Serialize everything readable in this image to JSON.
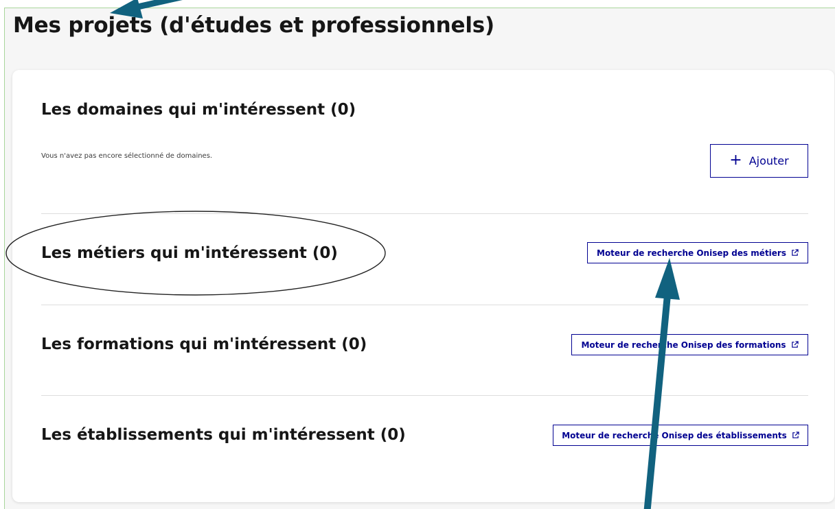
{
  "page": {
    "title": "Mes projets (d'études et professionnels)"
  },
  "sections": {
    "domaines": {
      "title": "Les domaines qui m'intéressent (0)",
      "empty_text": "Vous n'avez pas encore sélectionné de domaines.",
      "add_label": "Ajouter",
      "add_icon": "plus-icon"
    },
    "metiers": {
      "title": "Les métiers qui m'intéressent (0)",
      "link_label": "Moteur de recherche Onisep des métiers",
      "link_icon": "external-link-icon"
    },
    "formations": {
      "title": "Les formations qui m'intéressent (0)",
      "link_label": "Moteur de recherche Onisep des formations",
      "link_icon": "external-link-icon"
    },
    "etablissements": {
      "title": "Les établissements qui m'intéressent (0)",
      "link_label": "Moteur de recherche Onisep des établissements",
      "link_icon": "external-link-icon"
    }
  },
  "colors": {
    "accent": "#000091",
    "annotation_arrow": "#11627f",
    "frame_border": "#a8d59a",
    "text": "#161616"
  }
}
